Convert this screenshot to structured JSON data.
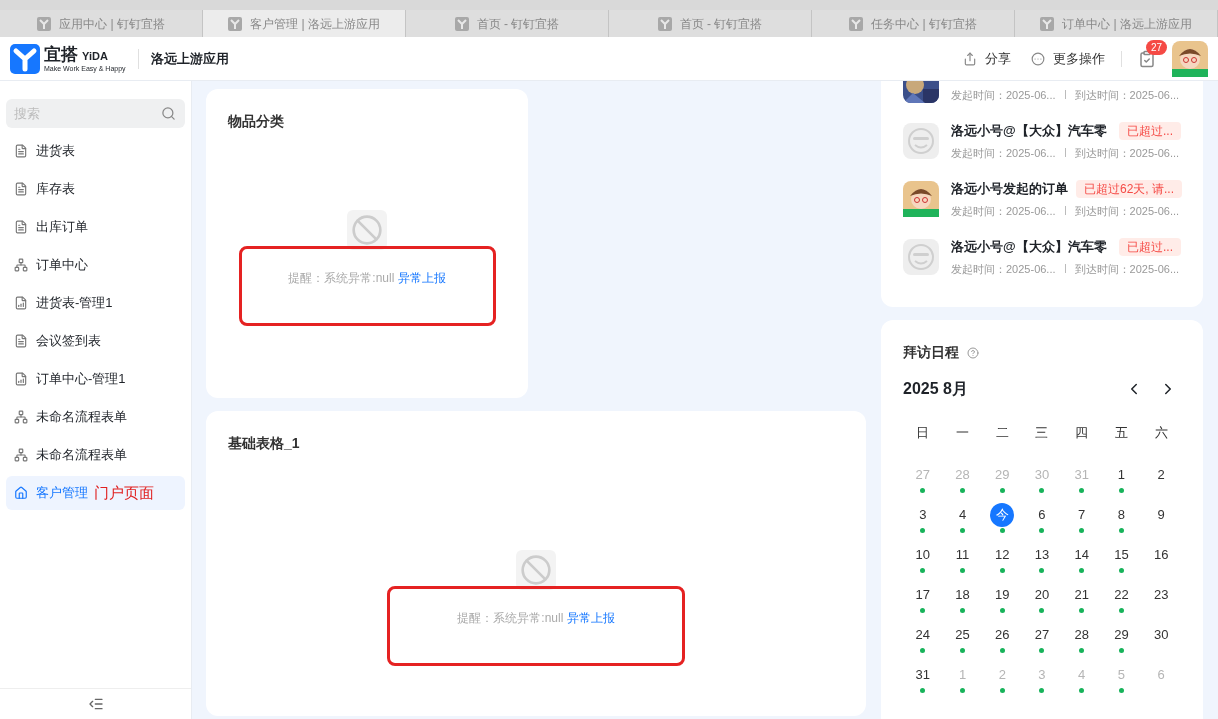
{
  "browser_tabs": [
    {
      "label": "应用中心 | 钉钉宜搭",
      "selected": false
    },
    {
      "label": "客户管理 | 洛远上游应用",
      "selected": true
    },
    {
      "label": "首页 - 钉钉宜搭",
      "selected": false
    },
    {
      "label": "首页 - 钉钉宜搭",
      "selected": false
    },
    {
      "label": "任务中心 | 钉钉宜搭",
      "selected": false
    },
    {
      "label": "订单中心 | 洛远上游应用",
      "selected": false
    }
  ],
  "header": {
    "logo_text": "宜搭",
    "logo_brand": "YiDA",
    "logo_slogan": "Make Work Easy & Happy",
    "app_name": "洛远上游应用",
    "share": "分享",
    "more": "更多操作",
    "task_badge": "27"
  },
  "sidebar": {
    "search_placeholder": "搜索",
    "items": [
      {
        "label": "进货表",
        "kind": "form",
        "selected": false
      },
      {
        "label": "库存表",
        "kind": "form",
        "selected": false
      },
      {
        "label": "出库订单",
        "kind": "form",
        "selected": false
      },
      {
        "label": "订单中心",
        "kind": "flow",
        "selected": false
      },
      {
        "label": "进货表-管理1",
        "kind": "report",
        "selected": false
      },
      {
        "label": "会议签到表",
        "kind": "form",
        "selected": false
      },
      {
        "label": "订单中心-管理1",
        "kind": "report",
        "selected": false
      },
      {
        "label": "未命名流程表单",
        "kind": "flow",
        "selected": false
      },
      {
        "label": "未命名流程表单",
        "kind": "flow",
        "selected": false
      },
      {
        "label": "客户管理",
        "kind": "home",
        "selected": true,
        "annotation": "门户页面"
      }
    ]
  },
  "cards": [
    {
      "title": "物品分类",
      "message": "提醒：系统异常:null",
      "link": "异常上报",
      "highlighted": true
    },
    {
      "title": "基础表格_1",
      "message": "提醒：系统异常:null",
      "link": "异常上报",
      "highlighted": true
    }
  ],
  "orders": [
    {
      "start": "发起时间：2025-06...",
      "arrive": "到达时间：2025-06..."
    },
    {
      "kind": "default",
      "title": "洛远小号@【大众】汽车零",
      "badge": "已超过...",
      "start": "发起时间：2025-06...",
      "arrive": "到达时间：2025-06..."
    },
    {
      "kind": "cartoon",
      "title": "洛远小号发起的订单",
      "badge": "已超过62天, 请...",
      "start": "发起时间：2025-06...",
      "arrive": "到达时间：2025-06..."
    },
    {
      "kind": "default",
      "title": "洛远小号@【大众】汽车零",
      "badge": "已超过...",
      "start": "发起时间：2025-06...",
      "arrive": "到达时间：2025-06..."
    }
  ],
  "calendar": {
    "title": "拜访日程",
    "month": "2025 8月",
    "weekdays": [
      "日",
      "一",
      "二",
      "三",
      "四",
      "五",
      "六"
    ],
    "weeks": [
      [
        {
          "day": "27",
          "muted": true,
          "dot": true,
          "selected": false
        },
        {
          "day": "28",
          "muted": true,
          "dot": true,
          "selected": false
        },
        {
          "day": "29",
          "muted": true,
          "dot": true,
          "selected": false
        },
        {
          "day": "30",
          "muted": true,
          "dot": true,
          "selected": false
        },
        {
          "day": "31",
          "muted": true,
          "dot": true,
          "selected": false
        },
        {
          "day": "1",
          "muted": false,
          "dot": true,
          "selected": false
        },
        {
          "day": "2",
          "muted": false,
          "dot": false,
          "selected": false
        }
      ],
      [
        {
          "day": "3",
          "muted": false,
          "dot": true,
          "selected": false
        },
        {
          "day": "4",
          "muted": false,
          "dot": true,
          "selected": false
        },
        {
          "day": "今",
          "muted": false,
          "dot": true,
          "selected": true
        },
        {
          "day": "6",
          "muted": false,
          "dot": true,
          "selected": false
        },
        {
          "day": "7",
          "muted": false,
          "dot": true,
          "selected": false
        },
        {
          "day": "8",
          "muted": false,
          "dot": true,
          "selected": false
        },
        {
          "day": "9",
          "muted": false,
          "dot": false,
          "selected": false
        }
      ],
      [
        {
          "day": "10",
          "muted": false,
          "dot": true,
          "selected": false
        },
        {
          "day": "11",
          "muted": false,
          "dot": true,
          "selected": false
        },
        {
          "day": "12",
          "muted": false,
          "dot": true,
          "selected": false
        },
        {
          "day": "13",
          "muted": false,
          "dot": true,
          "selected": false
        },
        {
          "day": "14",
          "muted": false,
          "dot": true,
          "selected": false
        },
        {
          "day": "15",
          "muted": false,
          "dot": true,
          "selected": false
        },
        {
          "day": "16",
          "muted": false,
          "dot": false,
          "selected": false
        }
      ],
      [
        {
          "day": "17",
          "muted": false,
          "dot": true,
          "selected": false
        },
        {
          "day": "18",
          "muted": false,
          "dot": true,
          "selected": false
        },
        {
          "day": "19",
          "muted": false,
          "dot": true,
          "selected": false
        },
        {
          "day": "20",
          "muted": false,
          "dot": true,
          "selected": false
        },
        {
          "day": "21",
          "muted": false,
          "dot": true,
          "selected": false
        },
        {
          "day": "22",
          "muted": false,
          "dot": true,
          "selected": false
        },
        {
          "day": "23",
          "muted": false,
          "dot": false,
          "selected": false
        }
      ],
      [
        {
          "day": "24",
          "muted": false,
          "dot": true,
          "selected": false
        },
        {
          "day": "25",
          "muted": false,
          "dot": true,
          "selected": false
        },
        {
          "day": "26",
          "muted": false,
          "dot": true,
          "selected": false
        },
        {
          "day": "27",
          "muted": false,
          "dot": true,
          "selected": false
        },
        {
          "day": "28",
          "muted": false,
          "dot": true,
          "selected": false
        },
        {
          "day": "29",
          "muted": false,
          "dot": true,
          "selected": false
        },
        {
          "day": "30",
          "muted": false,
          "dot": false,
          "selected": false
        }
      ],
      [
        {
          "day": "31",
          "muted": false,
          "dot": true,
          "selected": false
        },
        {
          "day": "1",
          "muted": true,
          "dot": true,
          "selected": false
        },
        {
          "day": "2",
          "muted": true,
          "dot": true,
          "selected": false
        },
        {
          "day": "3",
          "muted": true,
          "dot": true,
          "selected": false
        },
        {
          "day": "4",
          "muted": true,
          "dot": true,
          "selected": false
        },
        {
          "day": "5",
          "muted": true,
          "dot": true,
          "selected": false
        },
        {
          "day": "6",
          "muted": true,
          "dot": false,
          "selected": false
        }
      ]
    ]
  }
}
